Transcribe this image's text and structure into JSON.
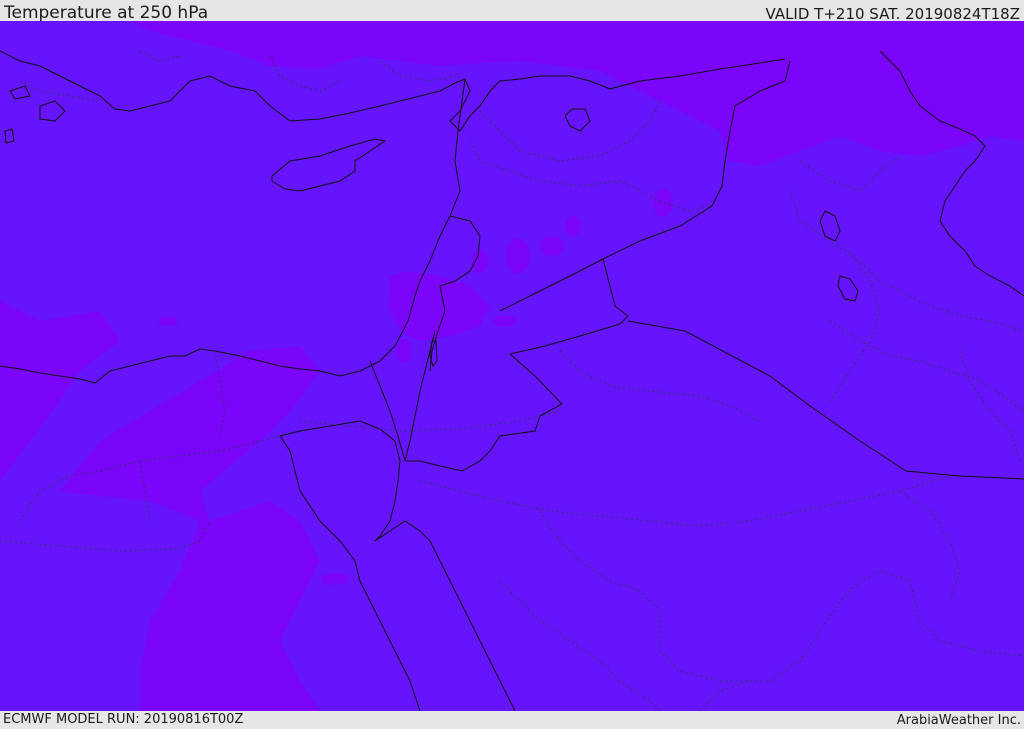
{
  "header": {
    "title": "Temperature at 250 hPa",
    "valid_time": "VALID T+210 SAT. 20190824T18Z"
  },
  "footer": {
    "model_run": "ECMWF MODEL RUN: 20190816T00Z",
    "credit": "ArabiaWeather Inc."
  },
  "map": {
    "colors": {
      "base_fill": "#6614fb",
      "warm_fill": "#7a05fa",
      "coastline": "#111111",
      "border": "#111111",
      "province_border": "#333366"
    }
  }
}
